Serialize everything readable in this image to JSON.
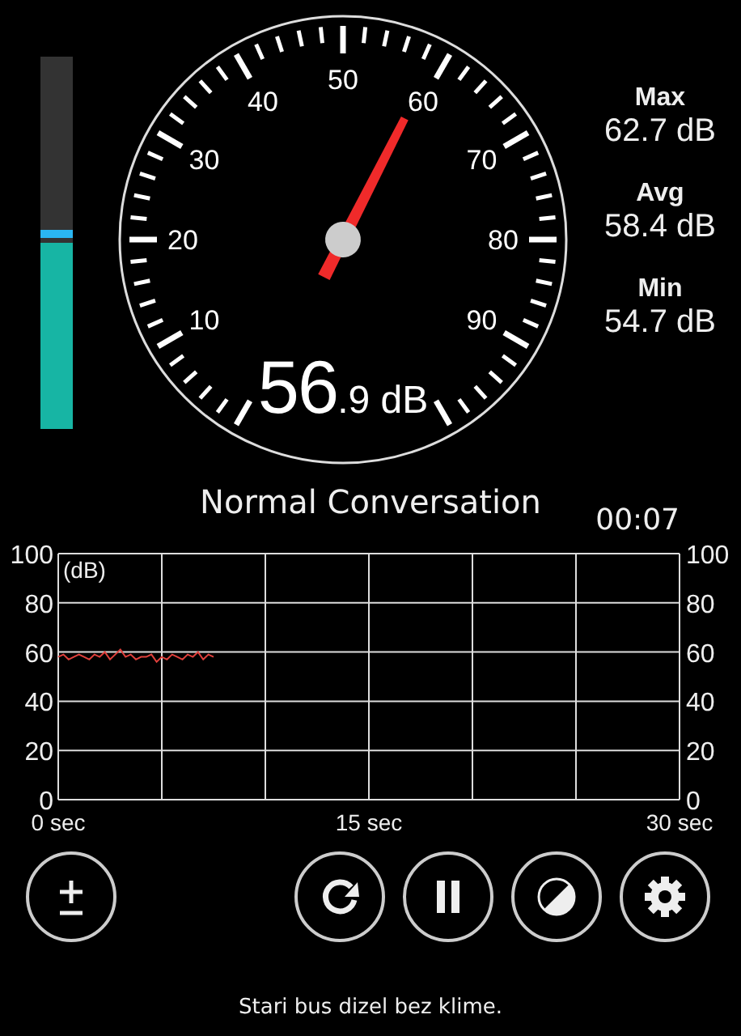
{
  "level_bar": {
    "level": 0.5,
    "peak_marker": {
      "level": 0.52
    }
  },
  "gauge": {
    "labels": [
      "10",
      "20",
      "30",
      "40",
      "50",
      "60",
      "70",
      "80",
      "90"
    ],
    "reading_main": "56",
    "reading_decimal": ".9",
    "reading_unit": "dB"
  },
  "stats": [
    {
      "label": "Max",
      "value": "62.7",
      "unit": "dB"
    },
    {
      "label": "Avg",
      "value": "58.4",
      "unit": "dB"
    },
    {
      "label": "Min",
      "value": "54.7",
      "unit": "dB"
    }
  ],
  "noise_level_name": "Normal Conversation",
  "timer": "00:07",
  "chart": {
    "chart_data": {
      "type": "line",
      "ylabel": "(dB)",
      "xlim": [
        0,
        30
      ],
      "ylim": [
        0,
        100
      ],
      "xticks": [
        {
          "value": 0,
          "label": "0 sec"
        },
        {
          "value": 15,
          "label": "15 sec"
        },
        {
          "value": 30,
          "label": "30 sec"
        }
      ],
      "yticks": [
        0,
        20,
        40,
        60,
        80,
        100
      ],
      "y2ticks": [
        0,
        20,
        40,
        60,
        80,
        100
      ],
      "y2lim": [
        0,
        100
      ],
      "grid": true,
      "x": [
        0,
        0.25,
        0.5,
        0.75,
        1,
        1.25,
        1.5,
        1.75,
        2,
        2.25,
        2.5,
        2.75,
        3,
        3.25,
        3.5,
        3.75,
        4,
        4.25,
        4.5,
        4.75,
        5,
        5.25,
        5.5,
        5.75,
        6,
        6.25,
        6.5,
        6.75,
        7,
        7.25,
        7.5
      ],
      "series": [
        {
          "color": "#e0403c",
          "values": [
            58,
            59,
            57,
            58,
            59,
            58,
            57,
            59,
            58,
            60,
            57,
            59,
            61,
            58,
            59,
            57,
            58,
            58,
            59,
            56,
            58,
            57,
            59,
            58,
            57,
            59,
            58,
            60,
            57,
            59,
            58
          ]
        }
      ]
    }
  },
  "buttons": [
    {
      "kind": "calibrate"
    },
    {
      "kind": "reset"
    },
    {
      "kind": "pause"
    },
    {
      "kind": "theme"
    },
    {
      "kind": "settings"
    }
  ],
  "caption": "Stari bus dizel bez klime."
}
